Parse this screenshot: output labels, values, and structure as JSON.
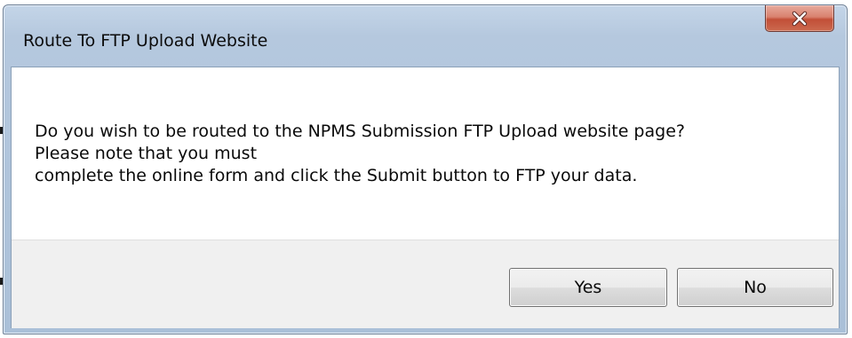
{
  "dialog": {
    "title": "Route To FTP Upload Website",
    "close_icon": "close-x-icon",
    "message": {
      "line1": "Do you wish to be routed to the NPMS Submission FTP Upload website page?",
      "line2": "Please note that you must",
      "line3": "complete the online form and click the Submit button to FTP your data."
    },
    "buttons": {
      "yes_label": "Yes",
      "no_label": "No"
    }
  },
  "colors": {
    "title_bar": "#b5c8de",
    "close_button": "#c24f37",
    "button_area": "#f0f0f0"
  }
}
